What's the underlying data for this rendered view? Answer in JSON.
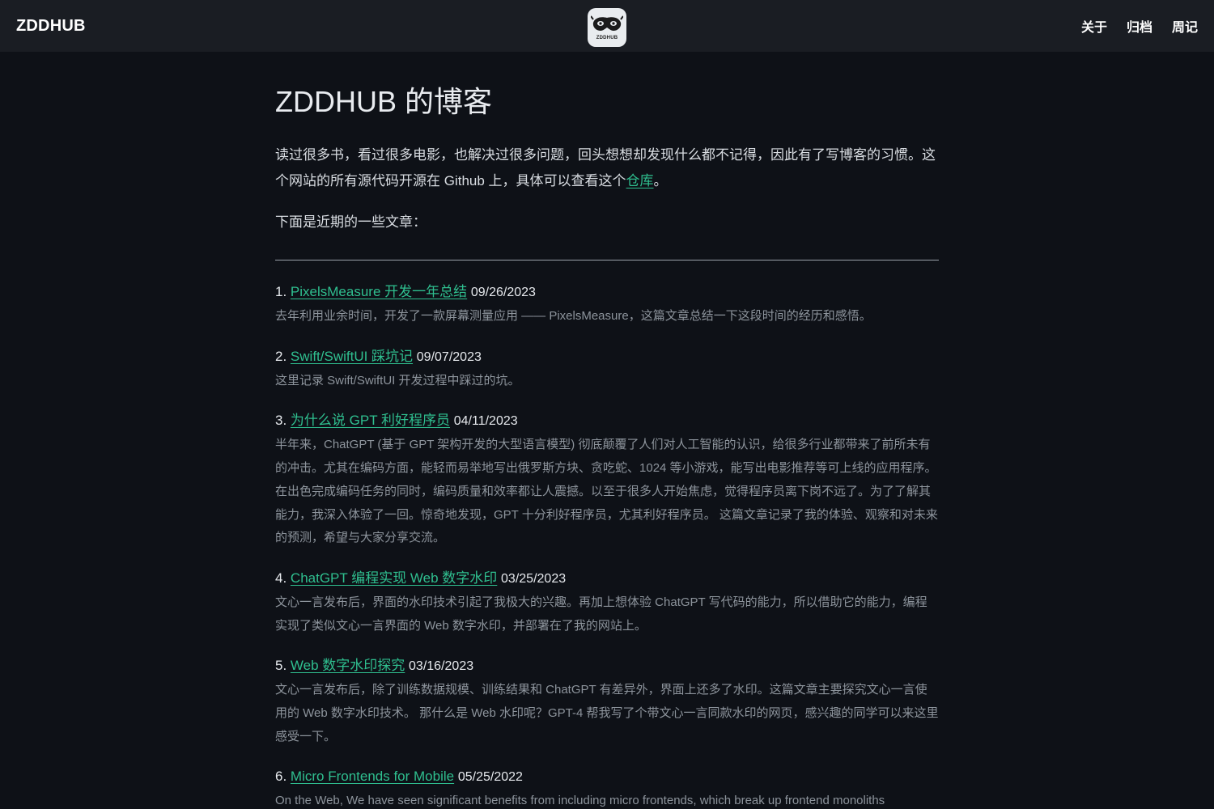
{
  "header": {
    "brand": "ZDDHUB",
    "logo_text": "ZDDHUB",
    "nav": [
      "关于",
      "归档",
      "周记"
    ]
  },
  "main": {
    "title": "ZDDHUB 的博客",
    "intro_before": "读过很多书，看过很多电影，也解决过很多问题，回头想想却发现什么都不记得，因此有了写博客的习惯。这个网站的所有源代码开源在 Github 上，具体可以查看这个",
    "intro_link": "仓库",
    "intro_after": "。",
    "recent_label": "下面是近期的一些文章："
  },
  "posts": [
    {
      "num": "1.",
      "title": "PixelsMeasure 开发一年总结",
      "date": "09/26/2023",
      "desc": "去年利用业余时间，开发了一款屏幕测量应用 —— PixelsMeasure，这篇文章总结一下这段时间的经历和感悟。"
    },
    {
      "num": "2.",
      "title": "Swift/SwiftUI 踩坑记",
      "date": "09/07/2023",
      "desc": "这里记录 Swift/SwiftUI 开发过程中踩过的坑。"
    },
    {
      "num": "3.",
      "title": "为什么说 GPT 利好程序员",
      "date": "04/11/2023",
      "desc": "半年来，ChatGPT (基于 GPT 架构开发的大型语言模型) 彻底颠覆了人们对人工智能的认识，给很多行业都带来了前所未有的冲击。尤其在编码方面，能轻而易举地写出俄罗斯方块、贪吃蛇、1024 等小游戏，能写出电影推荐等可上线的应用程序。在出色完成编码任务的同时，编码质量和效率都让人震撼。以至于很多人开始焦虑，觉得程序员离下岗不远了。为了了解其能力，我深入体验了一回。惊奇地发现，GPT 十分利好程序员，尤其利好程序员。 这篇文章记录了我的体验、观察和对未来的预测，希望与大家分享交流。"
    },
    {
      "num": "4.",
      "title": "ChatGPT 编程实现 Web 数字水印",
      "date": "03/25/2023",
      "desc": "文心一言发布后，界面的水印技术引起了我极大的兴趣。再加上想体验 ChatGPT 写代码的能力，所以借助它的能力，编程实现了类似文心一言界面的 Web 数字水印，并部署在了我的网站上。"
    },
    {
      "num": "5.",
      "title": "Web 数字水印探究",
      "date": "03/16/2023",
      "desc": "文心一言发布后，除了训练数据规模、训练结果和 ChatGPT 有差异外，界面上还多了水印。这篇文章主要探究文心一言使用的 Web 数字水印技术。 那什么是 Web 水印呢？GPT-4 帮我写了个带文心一言同款水印的网页，感兴趣的同学可以来这里感受一下。"
    },
    {
      "num": "6.",
      "title": "Micro Frontends for Mobile",
      "date": "05/25/2022",
      "desc": "On the Web, We have seen significant benefits from including micro frontends, which break up frontend monoliths"
    }
  ]
}
